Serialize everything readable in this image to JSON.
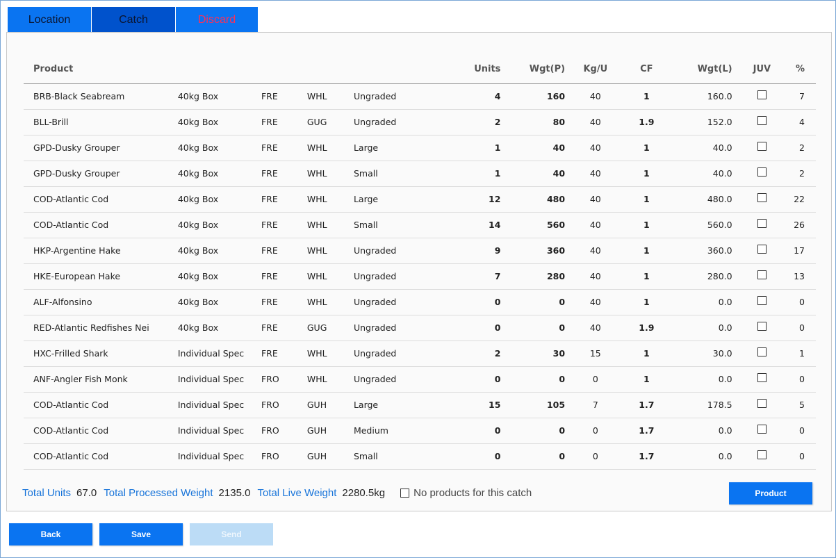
{
  "tabs": [
    {
      "label": "Location"
    },
    {
      "label": "Catch"
    },
    {
      "label": "Discard"
    }
  ],
  "table": {
    "headers": {
      "product": "Product",
      "units": "Units",
      "wgtp": "Wgt(P)",
      "kgu": "Kg/U",
      "cf": "CF",
      "wgtl": "Wgt(L)",
      "juv": "JUV",
      "pct": "%"
    },
    "rows": [
      {
        "product": "BRB-Black Seabream",
        "pack": "40kg Box",
        "pres": "FRE",
        "state": "WHL",
        "grade": "Ungraded",
        "units": "4",
        "wgtp": "160",
        "kgu": "40",
        "cf": "1",
        "wgtl": "160.0",
        "juv": false,
        "pct": "7"
      },
      {
        "product": "BLL-Brill",
        "pack": "40kg Box",
        "pres": "FRE",
        "state": "GUG",
        "grade": "Ungraded",
        "units": "2",
        "wgtp": "80",
        "kgu": "40",
        "cf": "1.9",
        "wgtl": "152.0",
        "juv": false,
        "pct": "4"
      },
      {
        "product": "GPD-Dusky Grouper",
        "pack": "40kg Box",
        "pres": "FRE",
        "state": "WHL",
        "grade": "Large",
        "units": "1",
        "wgtp": "40",
        "kgu": "40",
        "cf": "1",
        "wgtl": "40.0",
        "juv": false,
        "pct": "2"
      },
      {
        "product": "GPD-Dusky Grouper",
        "pack": "40kg Box",
        "pres": "FRE",
        "state": "WHL",
        "grade": "Small",
        "units": "1",
        "wgtp": "40",
        "kgu": "40",
        "cf": "1",
        "wgtl": "40.0",
        "juv": false,
        "pct": "2"
      },
      {
        "product": "COD-Atlantic Cod",
        "pack": "40kg Box",
        "pres": "FRE",
        "state": "WHL",
        "grade": "Large",
        "units": "12",
        "wgtp": "480",
        "kgu": "40",
        "cf": "1",
        "wgtl": "480.0",
        "juv": false,
        "pct": "22"
      },
      {
        "product": "COD-Atlantic Cod",
        "pack": "40kg Box",
        "pres": "FRE",
        "state": "WHL",
        "grade": "Small",
        "units": "14",
        "wgtp": "560",
        "kgu": "40",
        "cf": "1",
        "wgtl": "560.0",
        "juv": false,
        "pct": "26"
      },
      {
        "product": "HKP-Argentine Hake",
        "pack": "40kg Box",
        "pres": "FRE",
        "state": "WHL",
        "grade": "Ungraded",
        "units": "9",
        "wgtp": "360",
        "kgu": "40",
        "cf": "1",
        "wgtl": "360.0",
        "juv": false,
        "pct": "17"
      },
      {
        "product": "HKE-European Hake",
        "pack": "40kg Box",
        "pres": "FRE",
        "state": "WHL",
        "grade": "Ungraded",
        "units": "7",
        "wgtp": "280",
        "kgu": "40",
        "cf": "1",
        "wgtl": "280.0",
        "juv": false,
        "pct": "13"
      },
      {
        "product": "ALF-Alfonsino",
        "pack": "40kg Box",
        "pres": "FRE",
        "state": "WHL",
        "grade": "Ungraded",
        "units": "0",
        "wgtp": "0",
        "kgu": "40",
        "cf": "1",
        "wgtl": "0.0",
        "juv": false,
        "pct": "0"
      },
      {
        "product": "RED-Atlantic Redfishes Nei",
        "pack": "40kg Box",
        "pres": "FRE",
        "state": "GUG",
        "grade": "Ungraded",
        "units": "0",
        "wgtp": "0",
        "kgu": "40",
        "cf": "1.9",
        "wgtl": "0.0",
        "juv": false,
        "pct": "0"
      },
      {
        "product": "HXC-Frilled Shark",
        "pack": "Individual Specie",
        "pres": "FRE",
        "state": "WHL",
        "grade": "Ungraded",
        "units": "2",
        "wgtp": "30",
        "kgu": "15",
        "cf": "1",
        "wgtl": "30.0",
        "juv": false,
        "pct": "1"
      },
      {
        "product": "ANF-Angler Fish Monk",
        "pack": "Individual Specie",
        "pres": "FRO",
        "state": "WHL",
        "grade": "Ungraded",
        "units": "0",
        "wgtp": "0",
        "kgu": "0",
        "cf": "1",
        "wgtl": "0.0",
        "juv": false,
        "pct": "0"
      },
      {
        "product": "COD-Atlantic Cod",
        "pack": "Individual Specie",
        "pres": "FRO",
        "state": "GUH",
        "grade": "Large",
        "units": "15",
        "wgtp": "105",
        "kgu": "7",
        "cf": "1.7",
        "wgtl": "178.5",
        "juv": false,
        "pct": "5"
      },
      {
        "product": "COD-Atlantic Cod",
        "pack": "Individual Specie",
        "pres": "FRO",
        "state": "GUH",
        "grade": "Medium",
        "units": "0",
        "wgtp": "0",
        "kgu": "0",
        "cf": "1.7",
        "wgtl": "0.0",
        "juv": false,
        "pct": "0"
      },
      {
        "product": "COD-Atlantic Cod",
        "pack": "Individual Specie",
        "pres": "FRO",
        "state": "GUH",
        "grade": "Small",
        "units": "0",
        "wgtp": "0",
        "kgu": "0",
        "cf": "1.7",
        "wgtl": "0.0",
        "juv": false,
        "pct": "0"
      }
    ]
  },
  "totals": {
    "units_label": "Total Units",
    "units_value": "67.0",
    "processed_label": "Total Processed Weight",
    "processed_value": "2135.0",
    "live_label": "Total Live Weight",
    "live_value": "2280.5kg",
    "no_products_label": "No products for this catch"
  },
  "buttons": {
    "product": "Product",
    "back": "Back",
    "save": "Save",
    "send": "Send"
  },
  "colors": {
    "accent": "#0a74f1",
    "active_tab": "#0052cc",
    "discard_text": "#ff2f56",
    "label_blue": "#1673d9",
    "disabled_button": "#bcdcf6"
  }
}
